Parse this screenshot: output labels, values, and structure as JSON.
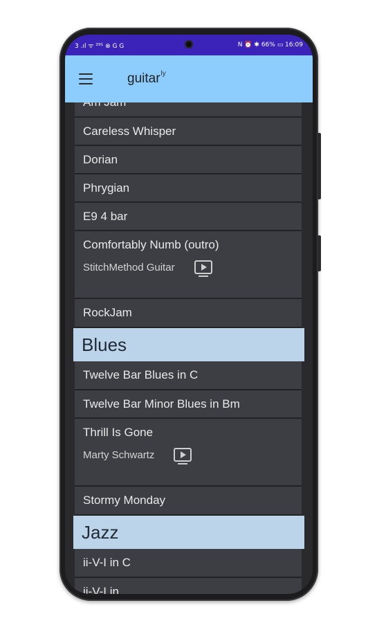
{
  "status": {
    "left": "3 .ıl ᯤ ²⁹¹ ⊗ G G",
    "right": "N ⏰ ✱ 66% ▭ 16:09"
  },
  "app": {
    "title": "guitar",
    "title_sup": "ly"
  },
  "list": {
    "items": [
      {
        "title": "Am Jam"
      },
      {
        "title": "Careless Whisper"
      },
      {
        "title": "Dorian"
      },
      {
        "title": "Phrygian"
      },
      {
        "title": "E9 4 bar"
      },
      {
        "title": "Comfortably Numb (outro)",
        "author": "StitchMethod Guitar"
      },
      {
        "title": "RockJam"
      },
      {
        "header": "Blues"
      },
      {
        "title": "Twelve Bar Blues in C"
      },
      {
        "title": "Twelve Bar Minor Blues in Bm"
      },
      {
        "title": "Thrill Is Gone",
        "author": "Marty Schwartz"
      },
      {
        "title": "Stormy Monday"
      },
      {
        "header": "Jazz"
      },
      {
        "title": "ii-V-I in C"
      },
      {
        "title": "ii-V-I in ..."
      }
    ]
  },
  "colors": {
    "status_bar": "#3b22b8",
    "app_bar": "#8ccdfd",
    "row_bg": "#3c3e43",
    "section_header_bg": "#bcd4ea"
  }
}
